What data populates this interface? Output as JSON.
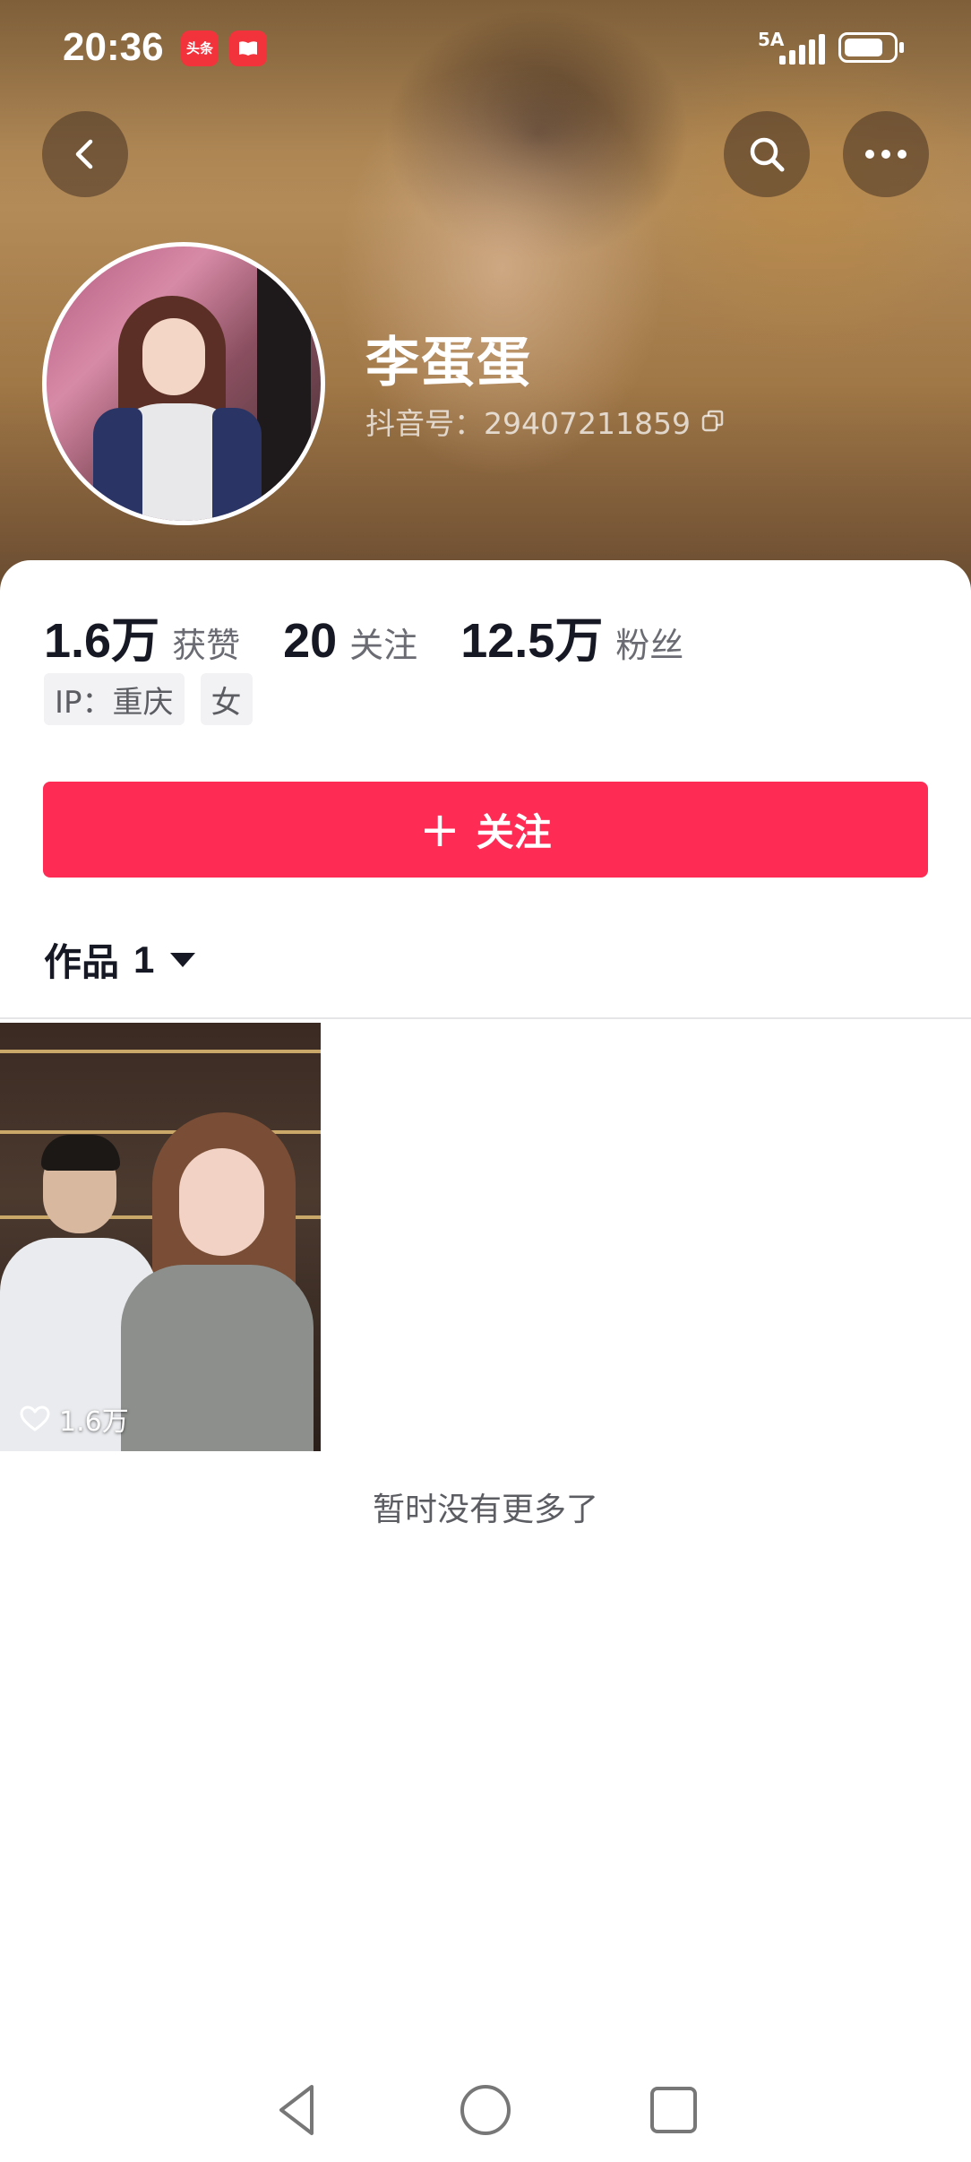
{
  "status_bar": {
    "time": "20:36",
    "app_badges": [
      "头条",
      "📕"
    ],
    "signal_label": "5A",
    "battery_level": 0.8
  },
  "header": {
    "back_icon": "chevron-left-icon",
    "search_icon": "search-icon",
    "more_icon": "more-horizontal-icon"
  },
  "profile": {
    "name": "李蛋蛋",
    "douyin_id": "抖音号：2940721185‍9",
    "stats": [
      {
        "value": "1.6万",
        "label": "获赞"
      },
      {
        "value": "20",
        "label": "关注"
      },
      {
        "value": "12.5万",
        "label": "粉丝"
      }
    ],
    "tags": [
      "IP：重庆",
      "女"
    ],
    "follow_label": "关注"
  },
  "works": {
    "tab_label": "作品",
    "count": "1",
    "videos": [
      {
        "likes": "1.6万"
      }
    ],
    "no_more_text": "暂时没有更多了"
  },
  "colors": {
    "accent": "#fe2c55",
    "text_primary": "#161823",
    "text_secondary": "#6b6c73"
  }
}
